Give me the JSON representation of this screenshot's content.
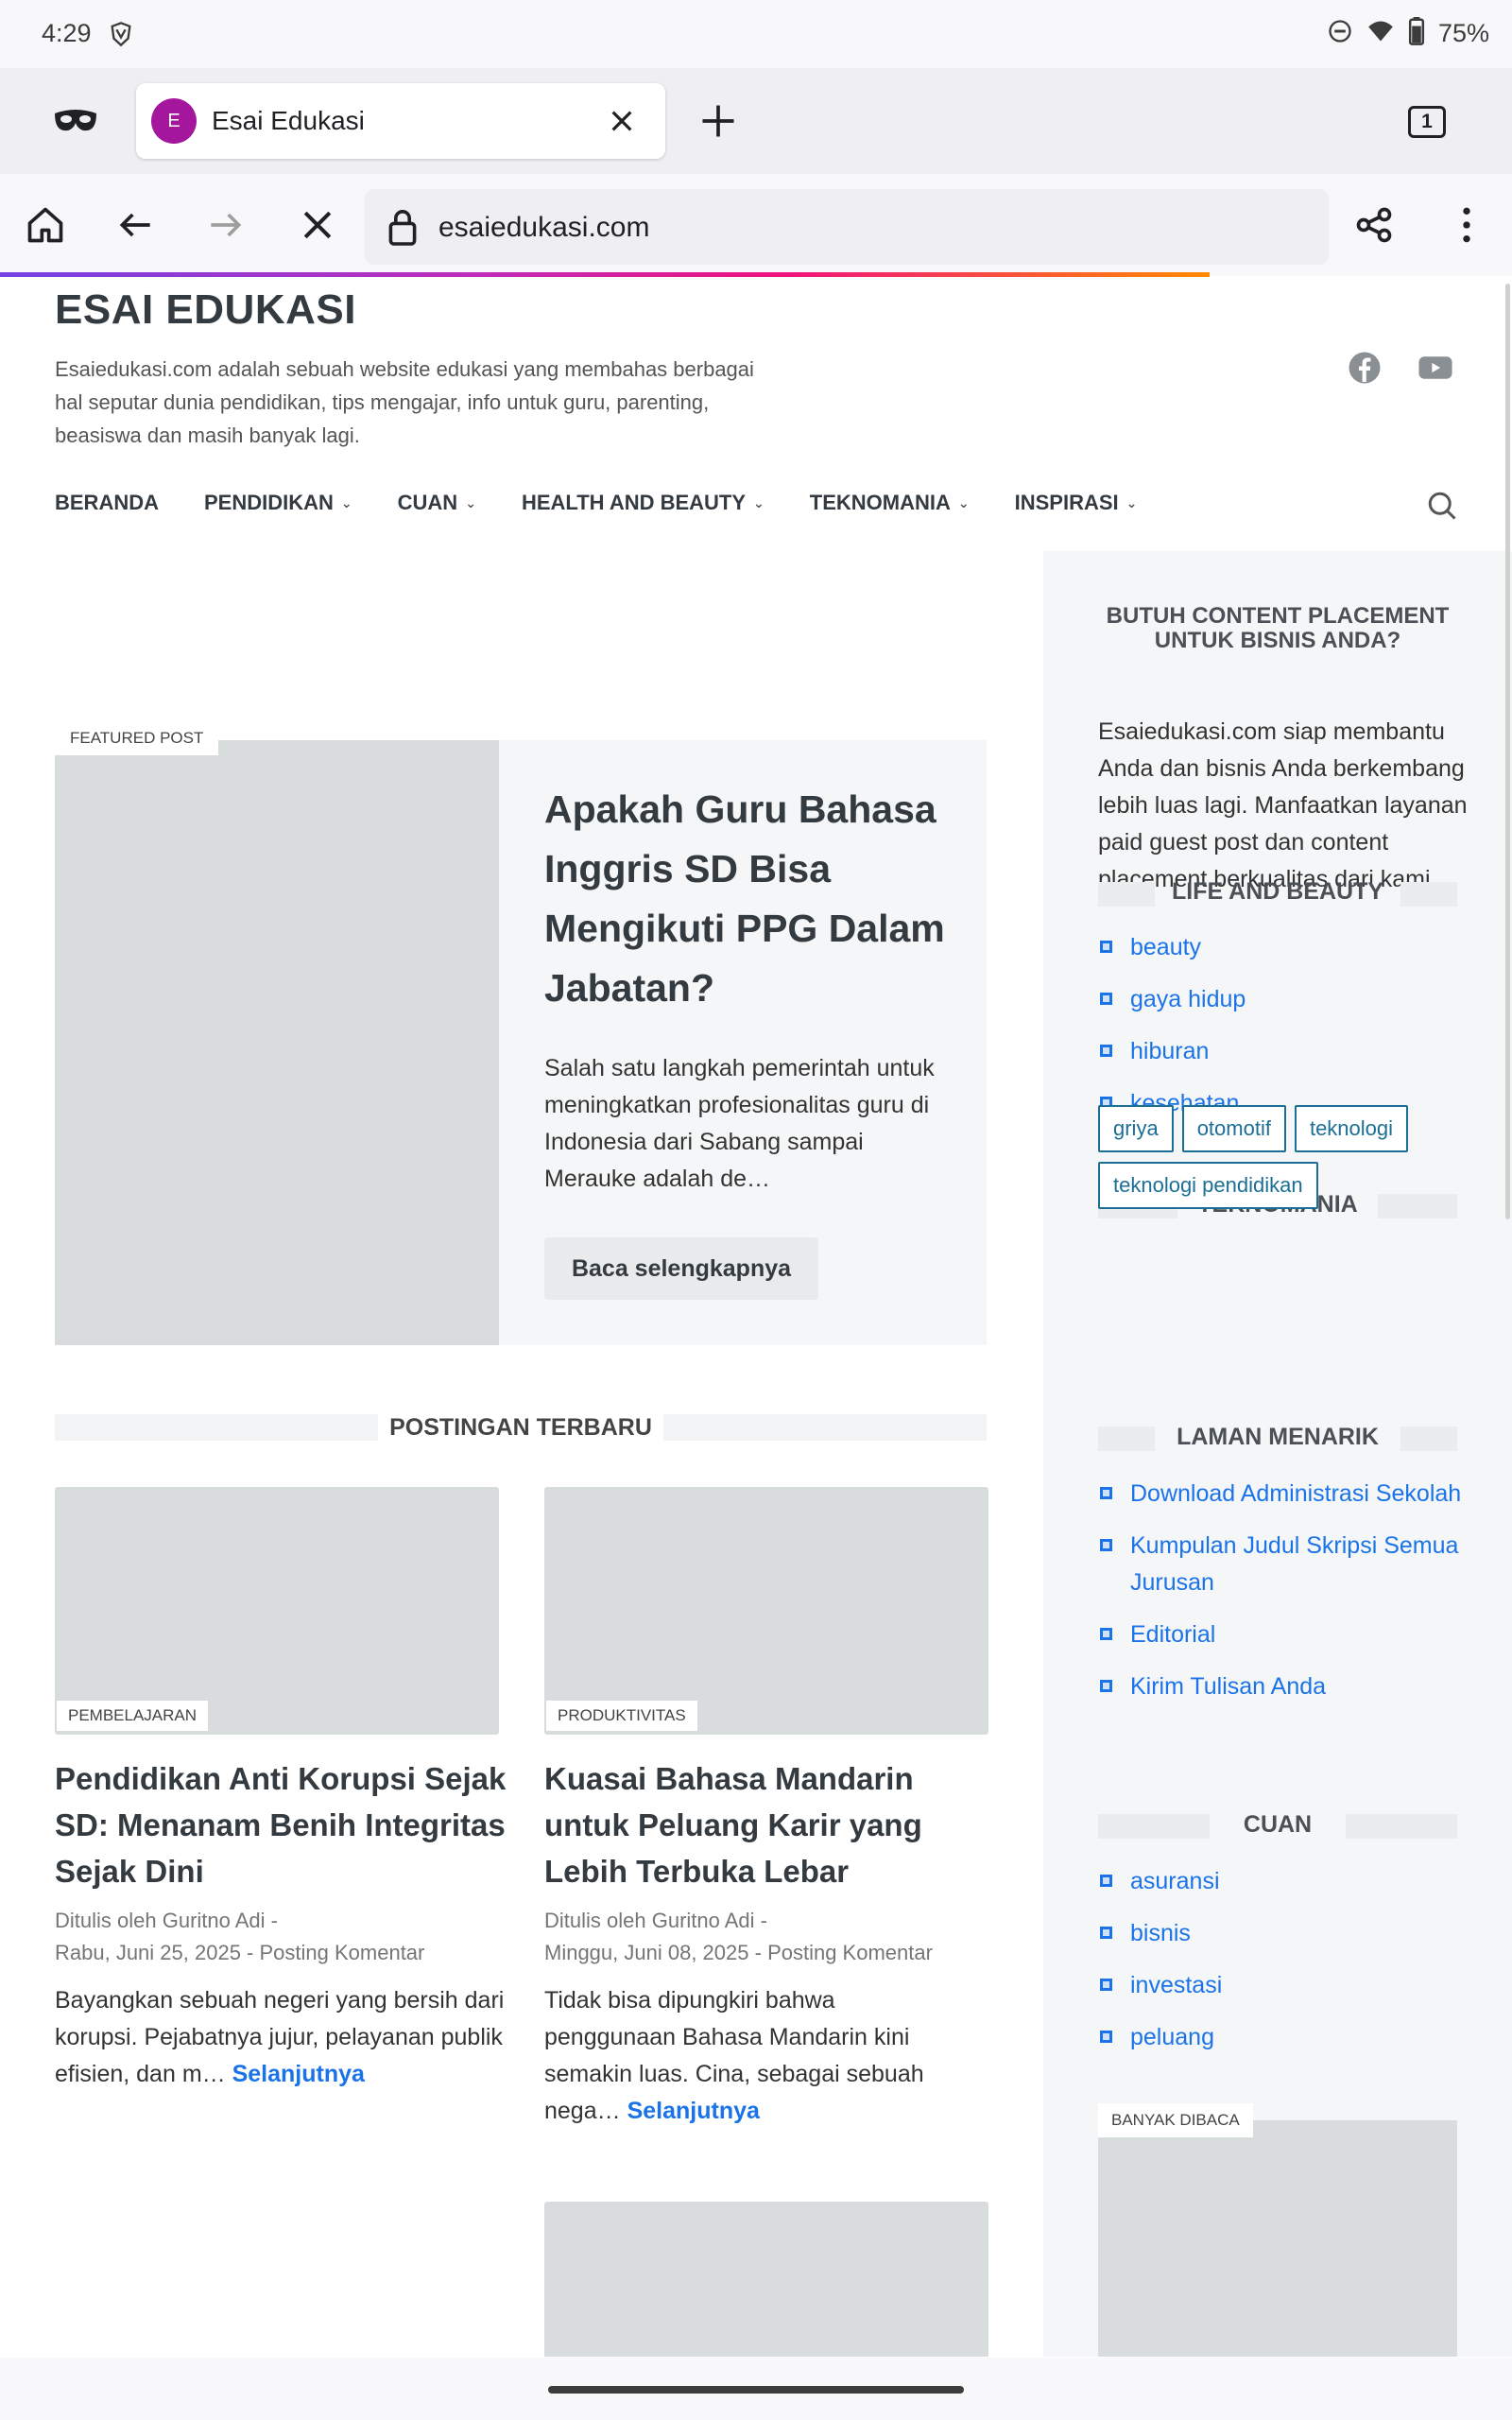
{
  "status_bar": {
    "time": "4:29",
    "battery": "75%"
  },
  "browser": {
    "tab": {
      "favicon_letter": "E",
      "title": "Esai Edukasi"
    },
    "tab_count": "1",
    "url": "esaiedukasi.com",
    "accent_color": "#7542e5"
  },
  "site": {
    "title": "ESAI EDUKASI",
    "description": "Esaiedukasi.com adalah sebuah website edukasi yang membahas berbagai hal seputar dunia pendidikan, tips mengajar, info untuk guru, parenting, beasiswa dan masih banyak lagi.",
    "nav": [
      {
        "label": "BERANDA",
        "dropdown": false
      },
      {
        "label": "PENDIDIKAN",
        "dropdown": true
      },
      {
        "label": "CUAN",
        "dropdown": true
      },
      {
        "label": "HEALTH AND BEAUTY",
        "dropdown": true
      },
      {
        "label": "TEKNOMANIA",
        "dropdown": true
      },
      {
        "label": "INSPIRASI",
        "dropdown": true
      }
    ]
  },
  "featured": {
    "label": "FEATURED POST",
    "title": "Apakah Guru Bahasa Inggris SD Bisa Mengikuti PPG Dalam Jabatan?",
    "excerpt": "Salah satu langkah pemerintah untuk meningkatkan profesionalitas guru di Indonesia dari Sabang sampai Merauke adalah de…",
    "button": "Baca selengkapnya"
  },
  "recent": {
    "heading": "POSTINGAN TERBARU",
    "posts": [
      {
        "label": "PEMBELAJARAN",
        "title": "Pendidikan Anti Korupsi Sejak SD: Menanam Benih Integritas Sejak Dini",
        "author": "Ditulis oleh Guritno Adi",
        "date": "Rabu, Juni 25, 2025",
        "comments": "Posting Komentar",
        "excerpt": "Bayangkan sebuah negeri yang bersih dari korupsi. Pejabatnya jujur, pelayanan publik efisien, dan m…",
        "more": "Selanjutnya"
      },
      {
        "label": "PRODUKTIVITAS",
        "title": "Kuasai Bahasa Mandarin untuk Peluang Karir yang Lebih Terbuka Lebar",
        "author": "Ditulis oleh Guritno Adi",
        "date": "Minggu, Juni 08, 2025",
        "comments": "Posting Komentar",
        "excerpt": "Tidak bisa dipungkiri bahwa penggunaan Bahasa Mandarin kini semakin luas. Cina, sebagai sebuah nega…",
        "more": "Selanjutnya"
      }
    ]
  },
  "sidebar": {
    "promo_heading": "BUTUH CONTENT PLACEMENT UNTUK BISNIS ANDA?",
    "promo_text": "Esaiedukasi.com siap membantu Anda dan bisnis Anda berkembang lebih luas lagi. Manfaatkan layanan paid guest post dan content placement berkualitas dari kami.",
    "life_heading": "LIFE AND BEAUTY",
    "life_items": [
      "beauty",
      "gaya hidup",
      "hiburan",
      "kesehatan"
    ],
    "tekno_heading": "TEKNOMANIA",
    "tekno_tags": [
      "griya",
      "otomotif",
      "teknologi",
      "teknologi pendidikan"
    ],
    "laman_heading": "LAMAN MENARIK",
    "laman_items": [
      "Download Administrasi Sekolah",
      "Kumpulan Judul Skripsi Semua Jurusan",
      "Editorial",
      "Kirim Tulisan Anda"
    ],
    "cuan_heading": "CUAN",
    "cuan_items": [
      "asuransi",
      "bisnis",
      "investasi",
      "peluang"
    ],
    "popular_label": "BANYAK DIBACA"
  },
  "icons": {
    "status": [
      "brave-shield-icon",
      "dnd-icon",
      "wifi-icon",
      "battery-icon"
    ],
    "browser": [
      "private-mask-icon",
      "close-tab-icon",
      "new-tab-icon",
      "home-icon",
      "back-icon",
      "forward-icon",
      "stop-icon",
      "lock-icon",
      "share-icon",
      "menu-icon"
    ],
    "site": [
      "facebook-icon",
      "youtube-icon",
      "search-icon"
    ]
  },
  "colors": {
    "link": "#1a73e8",
    "tag": "#1b6f95",
    "favicon": "#a4179c"
  }
}
